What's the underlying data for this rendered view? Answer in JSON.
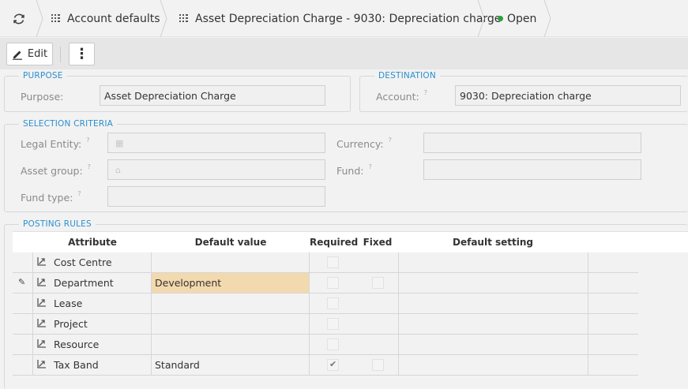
{
  "breadcrumb": {
    "items": [
      {
        "label": "Account defaults",
        "icon": "grid-icon"
      },
      {
        "label": "Asset Depreciation Charge - 9030: Depreciation charge",
        "icon": "grid-icon"
      }
    ],
    "status": "Open",
    "status_color": "#2e9e3a",
    "refresh_icon": "refresh-icon"
  },
  "toolbar": {
    "edit_label": "Edit",
    "more_label": "⋮"
  },
  "purpose": {
    "legend": "PURPOSE",
    "label": "Purpose:",
    "value": "Asset Depreciation Charge"
  },
  "destination": {
    "legend": "DESTINATION",
    "label": "Account:",
    "value": "9030: Depreciation charge"
  },
  "selection": {
    "legend": "SELECTION CRITERIA",
    "legal_entity_label": "Legal Entity:",
    "legal_entity_value": "",
    "asset_group_label": "Asset group:",
    "asset_group_value": "",
    "fund_type_label": "Fund type:",
    "fund_type_value": "",
    "currency_label": "Currency:",
    "currency_value": "",
    "fund_label": "Fund:",
    "fund_value": "",
    "help_mark": "?"
  },
  "posting_rules": {
    "legend": "POSTING RULES",
    "columns": [
      "Attribute",
      "Default value",
      "Required",
      "Fixed",
      "Default setting"
    ],
    "rows": [
      {
        "attribute": "Cost Centre",
        "default_value": "",
        "required": false,
        "fixed": null,
        "default_setting": "",
        "editing": false
      },
      {
        "attribute": "Department",
        "default_value": "Development",
        "required": false,
        "fixed": false,
        "default_setting": "",
        "editing": true
      },
      {
        "attribute": "Lease",
        "default_value": "",
        "required": false,
        "fixed": null,
        "default_setting": "",
        "editing": false
      },
      {
        "attribute": "Project",
        "default_value": "",
        "required": false,
        "fixed": null,
        "default_setting": "",
        "editing": false
      },
      {
        "attribute": "Resource",
        "default_value": "",
        "required": false,
        "fixed": null,
        "default_setting": "",
        "editing": false
      },
      {
        "attribute": "Tax Band",
        "default_value": "Standard",
        "required": true,
        "fixed": false,
        "default_setting": "",
        "editing": false
      }
    ]
  },
  "colors": {
    "accent": "#2a8fcf",
    "highlight": "#f3d9ae"
  }
}
